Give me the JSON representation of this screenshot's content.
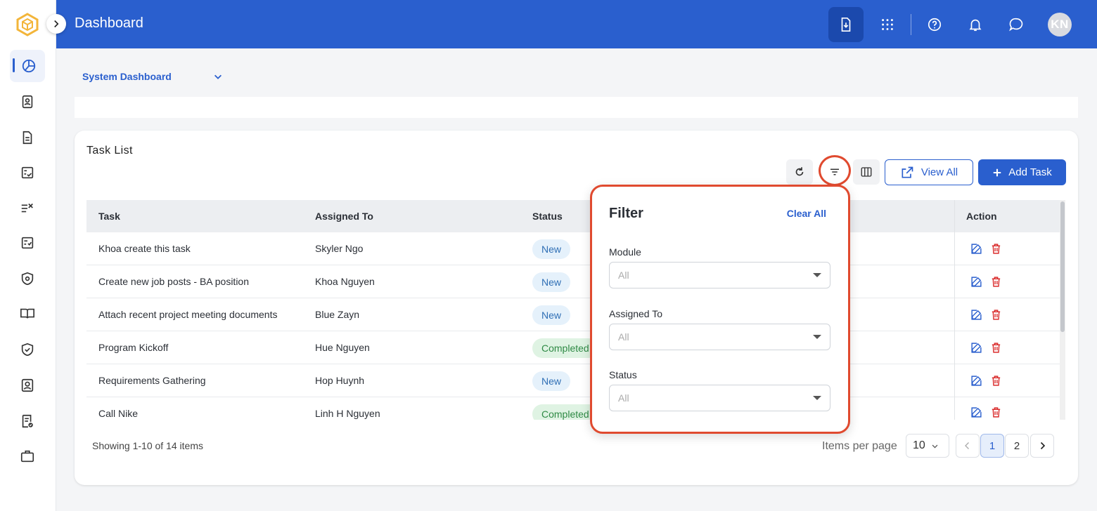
{
  "header": {
    "title": "Dashboard",
    "avatar_initials": "KN"
  },
  "sidebar": {
    "items": [
      {
        "name": "dashboard",
        "icon": "pie-chart-icon",
        "active": true
      },
      {
        "name": "contacts",
        "icon": "contact-book-icon"
      },
      {
        "name": "documents",
        "icon": "document-icon"
      },
      {
        "name": "tasks",
        "icon": "checklist-icon"
      },
      {
        "name": "task-list",
        "icon": "list-check-icon"
      },
      {
        "name": "checklist-2",
        "icon": "checkbox-list-icon"
      },
      {
        "name": "security",
        "icon": "shield-at-icon"
      },
      {
        "name": "knowledge",
        "icon": "book-open-icon"
      },
      {
        "name": "compliance",
        "icon": "shield-check-icon"
      },
      {
        "name": "users",
        "icon": "user-card-icon"
      },
      {
        "name": "reports",
        "icon": "report-check-icon"
      },
      {
        "name": "portfolio",
        "icon": "briefcase-icon"
      }
    ]
  },
  "dashboard_selector": {
    "label": "System Dashboard"
  },
  "task_list": {
    "title": "Task List",
    "view_all_label": "View All",
    "add_task_label": "Add Task",
    "columns": {
      "task": "Task",
      "assigned_to": "Assigned To",
      "status": "Status",
      "action": "Action"
    },
    "rows": [
      {
        "task": "Khoa create this task",
        "assigned_to": "Skyler Ngo",
        "status": "New"
      },
      {
        "task": "Create new job posts - BA position",
        "assigned_to": "Khoa Nguyen",
        "status": "New"
      },
      {
        "task": "Attach recent project meeting documents",
        "assigned_to": "Blue Zayn",
        "status": "New"
      },
      {
        "task": "Program Kickoff",
        "assigned_to": "Hue Nguyen",
        "status": "Completed"
      },
      {
        "task": "Requirements Gathering",
        "assigned_to": "Hop Huynh",
        "status": "New"
      },
      {
        "task": "Call Nike",
        "assigned_to": "Linh H Nguyen",
        "status": "Completed"
      }
    ],
    "showing_text": "Showing 1-10 of 14 items",
    "items_per_page_label": "Items per page",
    "items_per_page_value": "10",
    "pages": [
      "1",
      "2"
    ],
    "current_page": "1"
  },
  "filter": {
    "title": "Filter",
    "clear_all_label": "Clear All",
    "fields": [
      {
        "label": "Module",
        "value": "All"
      },
      {
        "label": "Assigned To",
        "value": "All"
      },
      {
        "label": "Status",
        "value": "All"
      }
    ]
  },
  "colors": {
    "primary": "#2a5fce",
    "highlight": "#e04a2f",
    "new_badge_bg": "#e5f1fb",
    "completed_badge_bg": "#dff3e3",
    "delete_red": "#d92b2b"
  }
}
